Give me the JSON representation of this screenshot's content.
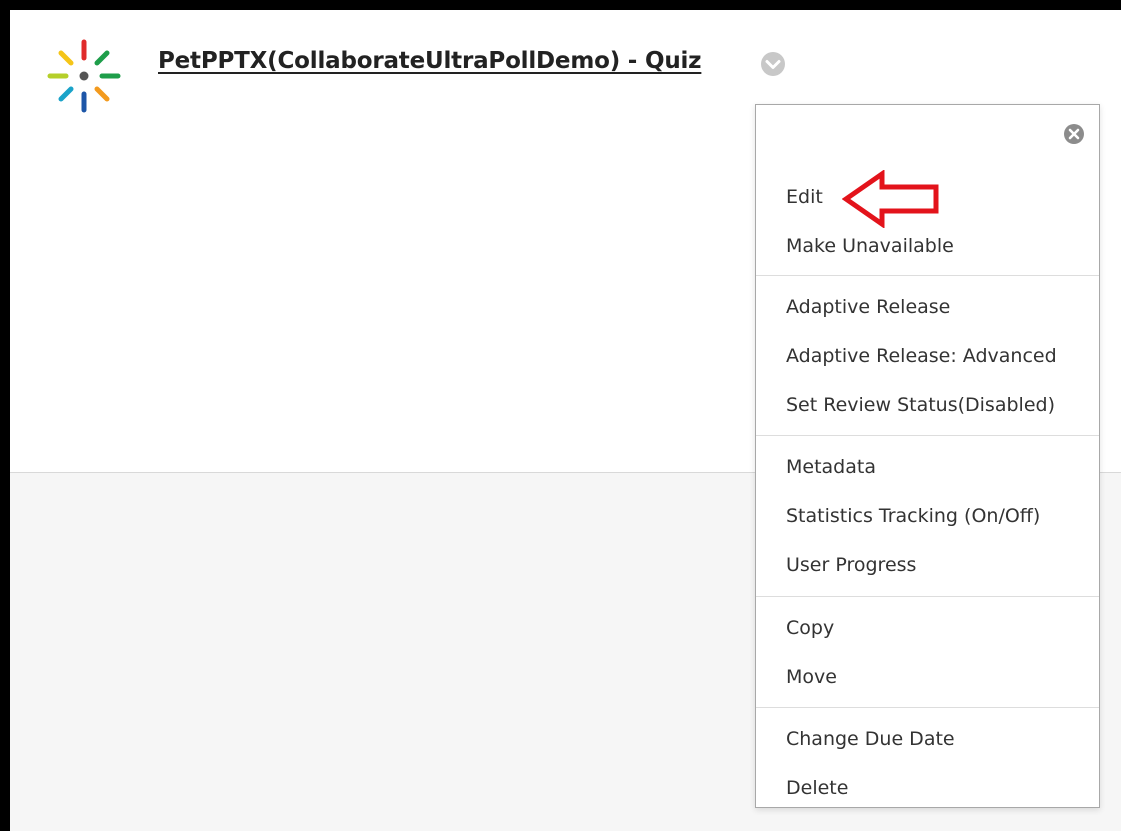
{
  "item": {
    "title": "PetPPTX(CollaborateUltraPollDemo) - Quiz"
  },
  "icons": {
    "logo": "starburst-logo",
    "title_menu": "chevron-down-circle-icon",
    "close": "close-circle-icon",
    "annotation": "red-arrow-left-icon"
  },
  "colors": {
    "annotation_red": "#e3131b",
    "logo_yellow": "#f5c518",
    "logo_red": "#e02b2b",
    "logo_green": "#1e9e4a",
    "logo_lime": "#b5cf2a",
    "logo_cyan": "#1aa3c9",
    "logo_blue": "#1d56a8",
    "logo_orange": "#f39a1e",
    "logo_center": "#555555"
  },
  "menu": {
    "groups": [
      {
        "items": [
          "Edit",
          "Make Unavailable"
        ]
      },
      {
        "items": [
          "Adaptive Release",
          "Adaptive Release: Advanced",
          "Set Review Status(Disabled)"
        ]
      },
      {
        "items": [
          "Metadata",
          "Statistics Tracking (On/Off)",
          "User Progress"
        ]
      },
      {
        "items": [
          "Copy",
          "Move"
        ]
      },
      {
        "items": [
          "Change Due Date",
          "Delete"
        ]
      }
    ]
  }
}
